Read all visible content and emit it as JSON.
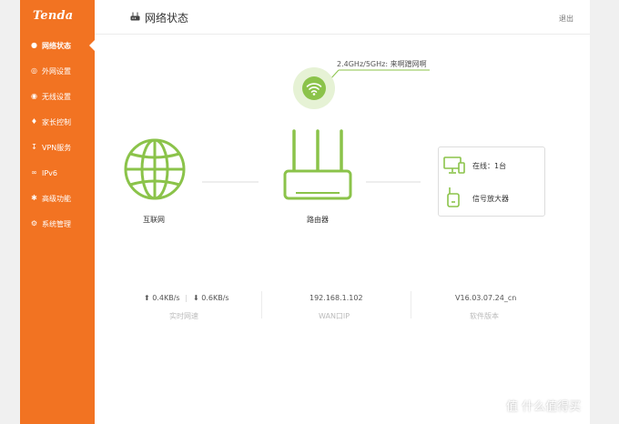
{
  "brand": {
    "logo_text": "Tenda",
    "accent_color": "#f27322",
    "icon_color": "#8bc34a"
  },
  "header": {
    "title": "网络状态",
    "title_icon": "router-icon",
    "logout_label": "退出"
  },
  "sidebar": {
    "items": [
      {
        "label": "网络状态",
        "icon": "person-icon",
        "active": true
      },
      {
        "label": "外网设置",
        "icon": "globe-icon",
        "active": false
      },
      {
        "label": "无线设置",
        "icon": "wifi-icon",
        "active": false
      },
      {
        "label": "家长控制",
        "icon": "family-icon",
        "active": false
      },
      {
        "label": "VPN服务",
        "icon": "download-icon",
        "active": false
      },
      {
        "label": "IPv6",
        "icon": "link-icon",
        "active": false
      },
      {
        "label": "高级功能",
        "icon": "tools-icon",
        "active": false
      },
      {
        "label": "系统管理",
        "icon": "settings-icon",
        "active": false
      }
    ]
  },
  "topology": {
    "wifi_ssid_label": "2.4GHz/5GHz: 来啊蹭网啊",
    "internet_label": "互联网",
    "router_label": "路由器",
    "clients": {
      "online_label": "在线：1台",
      "extender_label": "信号放大器"
    }
  },
  "stats": {
    "upload": "0.4KB/s",
    "download": "0.6KB/s",
    "speed_caption": "实时网速",
    "wan_ip": "192.168.1.102",
    "wan_caption": "WAN口IP",
    "firmware": "V16.03.07.24_cn",
    "firmware_caption": "软件版本"
  },
  "watermark": "值 什么值得买"
}
